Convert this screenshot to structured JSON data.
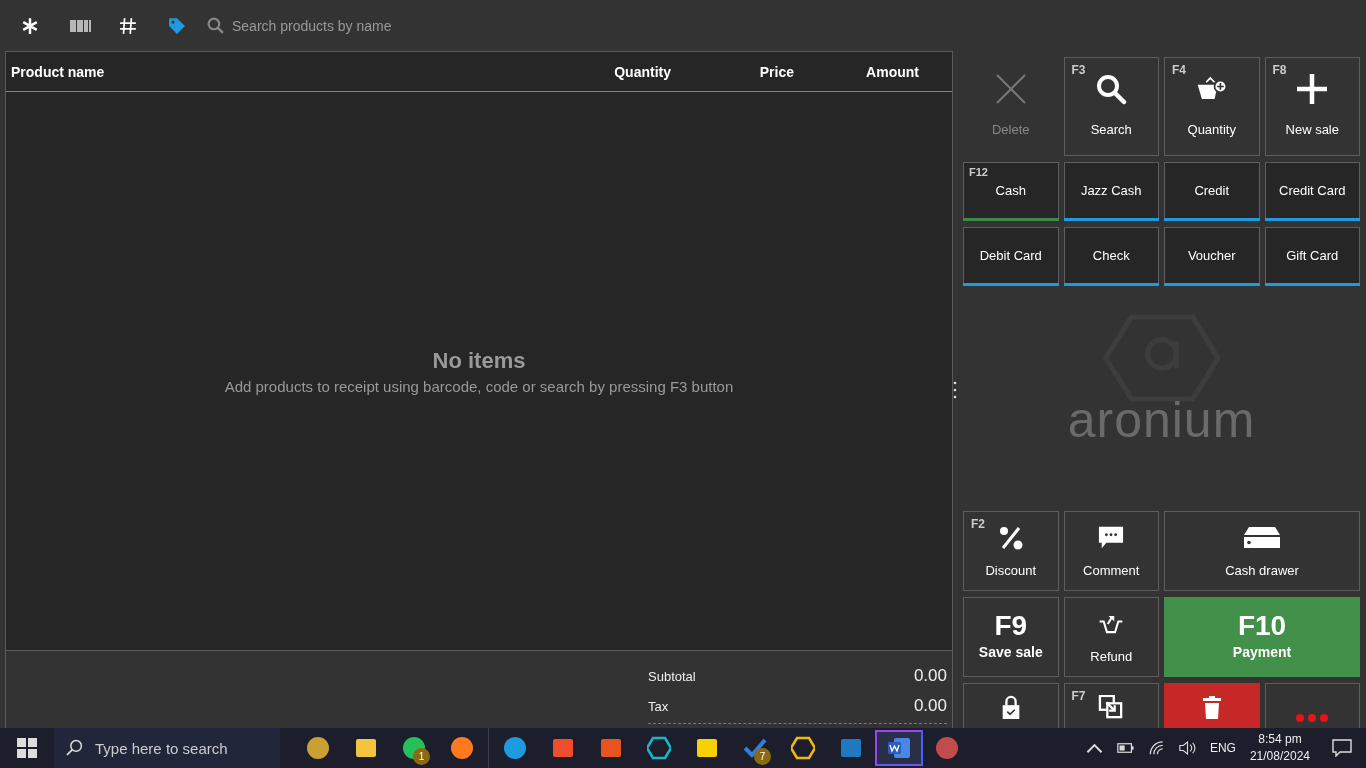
{
  "toolbar": {
    "search": {
      "placeholder": "Search products by name"
    }
  },
  "table": {
    "columns": [
      "Product name",
      "Quantity",
      "Price",
      "Amount"
    ]
  },
  "empty_state": {
    "title": "No items",
    "message": "Add products to receipt using barcode, code or search by pressing F3 button"
  },
  "totals": [
    {
      "label": "Subtotal",
      "value": "0.00"
    },
    {
      "label": "Tax",
      "value": "0.00"
    }
  ],
  "action_buttons": [
    {
      "kind": "delete",
      "label": "Delete",
      "disabled": true
    },
    {
      "kind": "search",
      "label": "Search",
      "shortcut": "F3",
      "disabled": false
    },
    {
      "kind": "quantity",
      "label": "Quantity",
      "shortcut": "F4",
      "disabled": false
    },
    {
      "kind": "new",
      "label": "New sale",
      "shortcut": "F8",
      "disabled": false
    }
  ],
  "payment_methods": [
    {
      "label": "Cash",
      "shortcut": "F12",
      "color": "#3f8a46"
    },
    {
      "label": "Jazz Cash",
      "color": "#1e9ae0"
    },
    {
      "label": "Credit",
      "color": "#1e9ae0"
    },
    {
      "label": "Credit Card",
      "color": "#1e9ae0"
    },
    {
      "label": "Debit Card",
      "color": "#1e9ae0"
    },
    {
      "label": "Check",
      "color": "#1e9ae0"
    },
    {
      "label": "Voucher",
      "color": "#1e9ae0"
    },
    {
      "label": "Gift Card",
      "color": "#1e9ae0"
    }
  ],
  "brand": {
    "name": "aronium"
  },
  "function_buttons": [
    {
      "kind": "discount",
      "label": "Discount",
      "shortcut": "F2"
    },
    {
      "kind": "comment",
      "label": "Comment"
    },
    {
      "kind": "drawer",
      "label": "Cash drawer"
    },
    {
      "kind": "save",
      "label": "Save sale",
      "key": "F9"
    },
    {
      "kind": "refund",
      "label": "Refund"
    },
    {
      "kind": "payment",
      "label": "Payment",
      "key": "F10"
    },
    {
      "kind": "lock"
    },
    {
      "kind": "transfer",
      "shortcut": "F7"
    },
    {
      "kind": "void"
    },
    {
      "kind": "more"
    }
  ],
  "taskbar": {
    "search": {
      "placeholder": "Type here to search"
    },
    "apps": [
      {
        "kind": "mask",
        "selected": false
      },
      {
        "kind": "folder",
        "selected": false
      },
      {
        "kind": "chat",
        "badge": "1",
        "selected": false
      },
      {
        "kind": "fox",
        "selected": false
      },
      {
        "kind": "edge",
        "selected": false
      },
      {
        "kind": "lion",
        "selected": false
      },
      {
        "kind": "orange",
        "selected": false
      },
      {
        "kind": "hex",
        "selected": false
      },
      {
        "kind": "note",
        "selected": false
      },
      {
        "kind": "check",
        "badge": "7",
        "selected": false
      },
      {
        "kind": "diamond",
        "selected": false
      },
      {
        "kind": "chart",
        "selected": false
      },
      {
        "kind": "word",
        "selected": true
      },
      {
        "kind": "snip",
        "selected": false
      }
    ],
    "language": "ENG",
    "time": "8:54 pm",
    "date": "21/08/2024"
  }
}
